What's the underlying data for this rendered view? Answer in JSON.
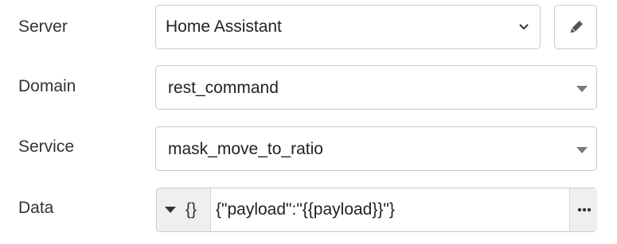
{
  "fields": {
    "server": {
      "label": "Server",
      "value": "Home Assistant",
      "edit_icon": "pencil-icon"
    },
    "domain": {
      "label": "Domain",
      "value": "rest_command"
    },
    "service": {
      "label": "Service",
      "value": "mask_move_to_ratio"
    },
    "data": {
      "label": "Data",
      "type_glyph": "{}",
      "value": "{\"payload\":\"{{payload}}\"}",
      "expand_icon": "ellipsis-icon"
    }
  },
  "colors": {
    "border": "#c9c9c9",
    "addon_bg": "#efefef",
    "text": "#333333"
  }
}
